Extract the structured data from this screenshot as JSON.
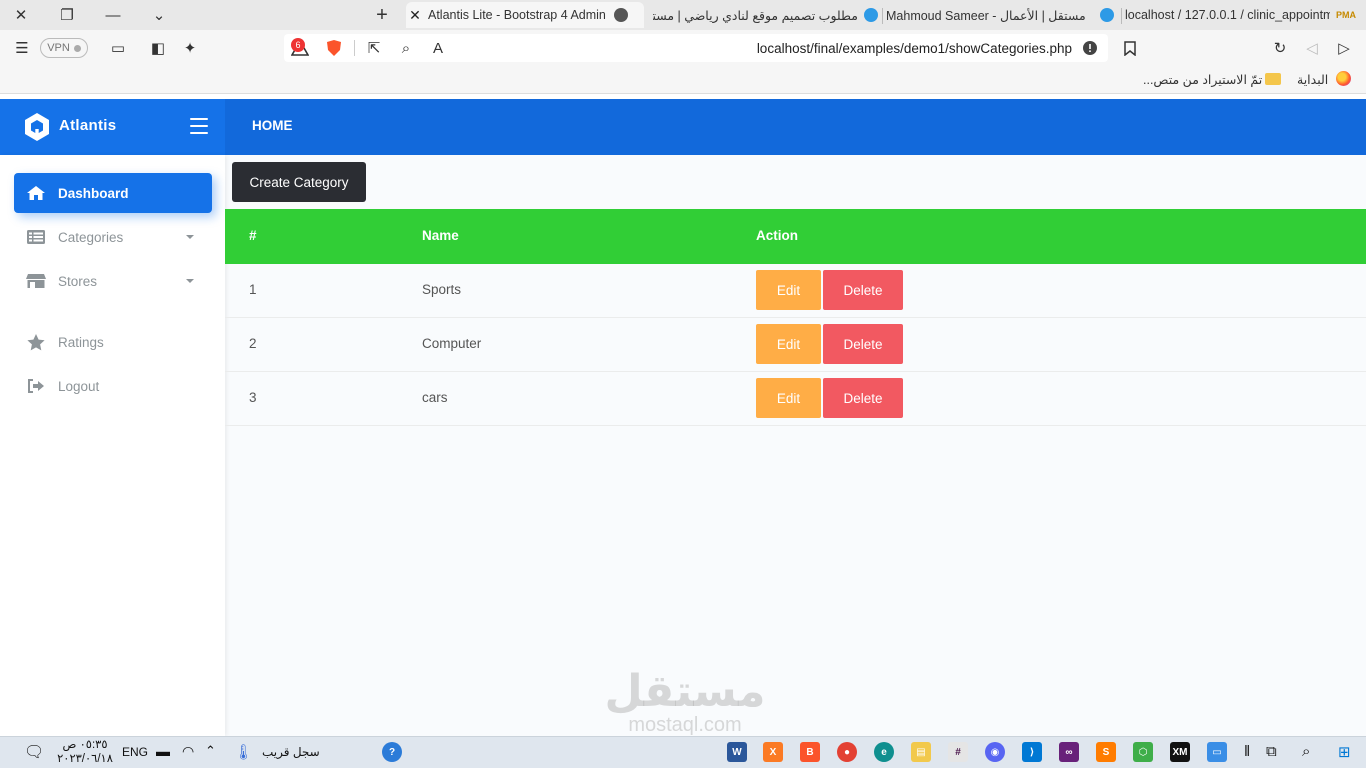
{
  "browser": {
    "tabs": [
      {
        "title": "localhost / 127.0.0.1 / clinic_appointm",
        "active": false
      },
      {
        "title": "Mahmoud Sameer - مستقل | الأعمال",
        "active": false
      },
      {
        "title": "مطلوب تصميم موقع لنادي رياضي | مستقل",
        "active": false
      },
      {
        "title": "Atlantis Lite - Bootstrap 4 Admin",
        "active": true
      }
    ],
    "vpn_label": "VPN",
    "shield_count": "6",
    "url": "localhost/final/examples/demo1/showCategories.php",
    "bookmarks": {
      "home": "البداية",
      "imported": "تمّ الاستيراد من متص..."
    }
  },
  "app": {
    "brand": "Atlantis",
    "topnav_home": "HOME",
    "sidebar": {
      "items": [
        {
          "label": "Dashboard",
          "icon": "home-icon",
          "active": true,
          "has_caret": false
        },
        {
          "label": "Categories",
          "icon": "list-icon",
          "active": false,
          "has_caret": true
        },
        {
          "label": "Stores",
          "icon": "store-icon",
          "active": false,
          "has_caret": true
        },
        {
          "label": "Ratings",
          "icon": "star-icon",
          "active": false,
          "has_caret": false
        },
        {
          "label": "Logout",
          "icon": "sign-out-icon",
          "active": false,
          "has_caret": false
        }
      ]
    },
    "create_button": "Create Category",
    "table": {
      "headers": [
        "#",
        "Name",
        "Action"
      ],
      "rows": [
        {
          "id": "1",
          "name": "Sports",
          "edit": "Edit",
          "delete": "Delete"
        },
        {
          "id": "2",
          "name": "Computer",
          "edit": "Edit",
          "delete": "Delete"
        },
        {
          "id": "3",
          "name": "cars",
          "edit": "Edit",
          "delete": "Delete"
        }
      ]
    },
    "colors": {
      "primary": "#1572e8",
      "secondary": "#1269db",
      "success": "#31ce36",
      "warning": "#ffad46",
      "danger": "#f25961",
      "dark": "#2b2d33"
    }
  },
  "watermark": {
    "arabic": "مستقل",
    "latin": "mostaql.com"
  },
  "taskbar": {
    "time": "٠٥:٣٥ ص",
    "date": "٢٠٢٣/٠٦/١٨",
    "language": "ENG",
    "weather": "سجل قريب"
  }
}
